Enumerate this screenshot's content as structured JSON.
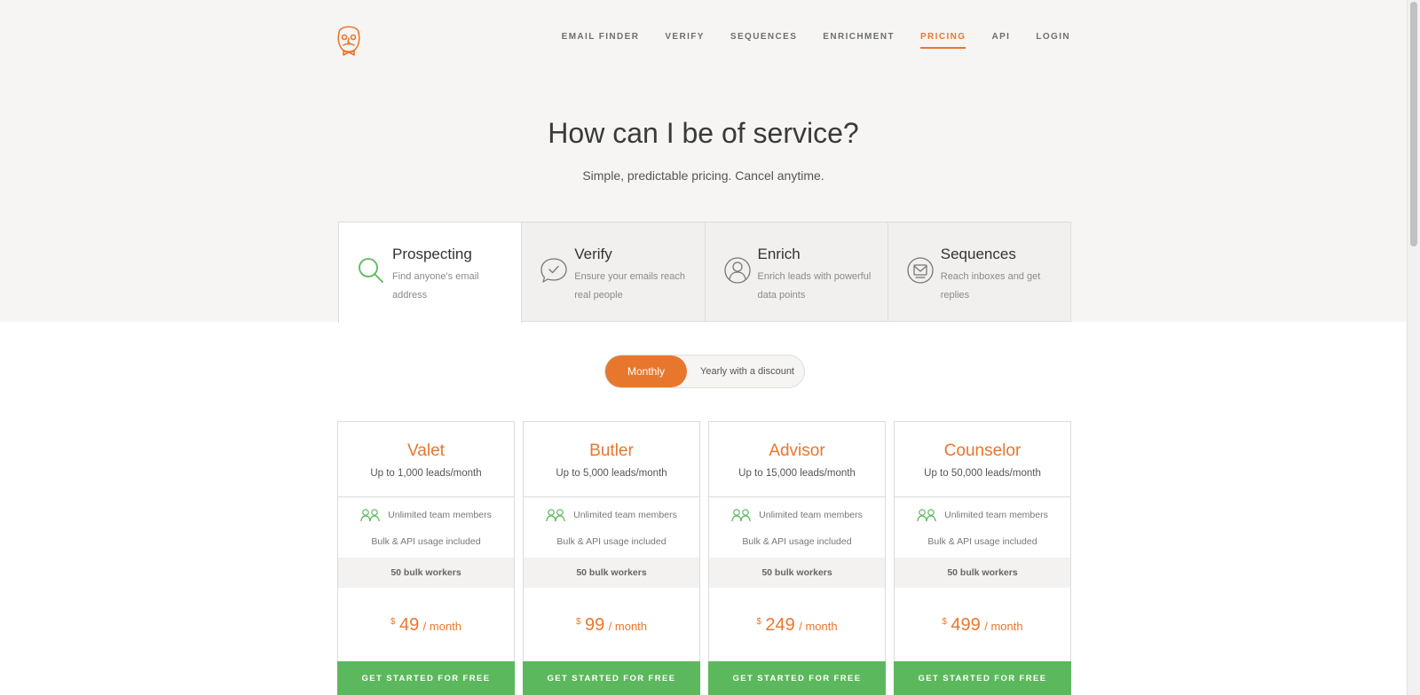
{
  "colors": {
    "accent": "#e8772e",
    "cta": "#5cb85c",
    "icon_green": "#5cb85c"
  },
  "nav": [
    {
      "label": "EMAIL FINDER"
    },
    {
      "label": "VERIFY"
    },
    {
      "label": "SEQUENCES"
    },
    {
      "label": "ENRICHMENT"
    },
    {
      "label": "PRICING",
      "active": true
    },
    {
      "label": "API"
    },
    {
      "label": "LOGIN"
    }
  ],
  "hero": {
    "title": "How can I be of service?",
    "subtitle": "Simple, predictable pricing. Cancel anytime."
  },
  "products": [
    {
      "title": "Prospecting",
      "desc": "Find anyone's email address",
      "icon": "search-icon",
      "selected": true
    },
    {
      "title": "Verify",
      "desc": "Ensure your emails reach real people",
      "icon": "check-bubble-icon"
    },
    {
      "title": "Enrich",
      "desc": "Enrich leads with powerful data points",
      "icon": "person-circle-icon"
    },
    {
      "title": "Sequences",
      "desc": "Reach inboxes and get replies",
      "icon": "envelope-circle-icon"
    }
  ],
  "billing": {
    "monthly": "Monthly",
    "yearly": "Yearly with a discount",
    "selected": "Monthly"
  },
  "plans": [
    {
      "name": "Valet",
      "leads": "Up to 1,000 leads/month",
      "team": "Unlimited team members",
      "bulk": "Bulk & API usage included",
      "workers": "50 bulk workers",
      "currency": "$",
      "price": "49",
      "per": "/ month",
      "cta": "GET STARTED FOR FREE"
    },
    {
      "name": "Butler",
      "leads": "Up to 5,000 leads/month",
      "team": "Unlimited team members",
      "bulk": "Bulk & API usage included",
      "workers": "50 bulk workers",
      "currency": "$",
      "price": "99",
      "per": "/ month",
      "cta": "GET STARTED FOR FREE"
    },
    {
      "name": "Advisor",
      "leads": "Up to 15,000 leads/month",
      "team": "Unlimited team members",
      "bulk": "Bulk & API usage included",
      "workers": "50 bulk workers",
      "currency": "$",
      "price": "249",
      "per": "/ month",
      "cta": "GET STARTED FOR FREE"
    },
    {
      "name": "Counselor",
      "leads": "Up to 50,000 leads/month",
      "team": "Unlimited team members",
      "bulk": "Bulk & API usage included",
      "workers": "50 bulk workers",
      "currency": "$",
      "price": "499",
      "per": "/ month",
      "cta": "GET STARTED FOR FREE"
    }
  ]
}
